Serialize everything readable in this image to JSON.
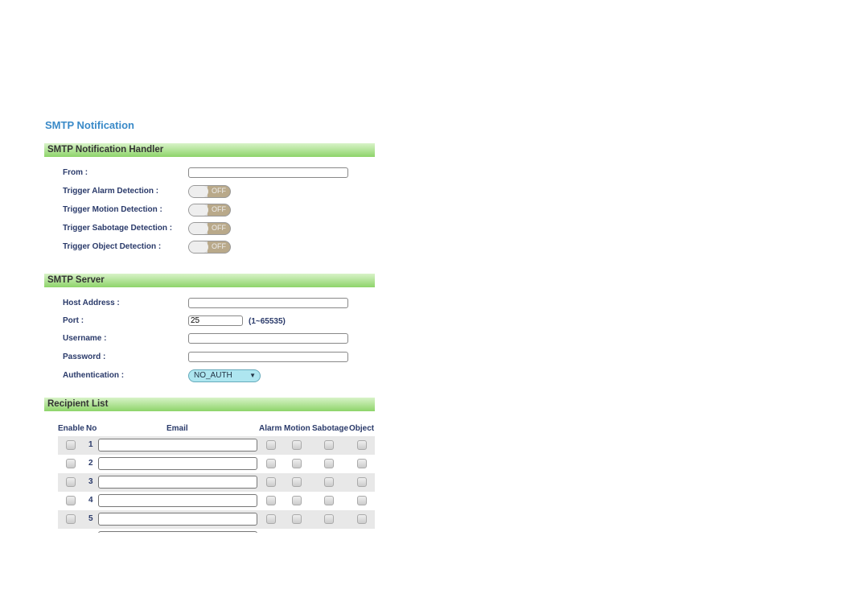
{
  "page_title": "SMTP Notification",
  "handler": {
    "header": "SMTP Notification Handler",
    "from_label": "From :",
    "from_value": "",
    "triggers": [
      {
        "label": "Trigger Alarm Detection :",
        "state": "OFF"
      },
      {
        "label": "Trigger Motion Detection :",
        "state": "OFF"
      },
      {
        "label": "Trigger Sabotage Detection :",
        "state": "OFF"
      },
      {
        "label": "Trigger Object Detection :",
        "state": "OFF"
      }
    ]
  },
  "server": {
    "header": "SMTP Server",
    "host_label": "Host Address :",
    "host_value": "",
    "port_label": "Port :",
    "port_value": "25",
    "port_range": "(1~65535)",
    "username_label": "Username :",
    "password_label": "Password :",
    "auth_label": "Authentication :",
    "auth_value": "NO_AUTH"
  },
  "recipients": {
    "header": "Recipient List",
    "columns": [
      "Enable",
      "No",
      "Email",
      "Alarm",
      "Motion",
      "Sabotage",
      "Object"
    ],
    "rows": [
      {
        "no": "1"
      },
      {
        "no": "2"
      },
      {
        "no": "3"
      },
      {
        "no": "4"
      },
      {
        "no": "5"
      },
      {
        "no": ""
      }
    ]
  }
}
